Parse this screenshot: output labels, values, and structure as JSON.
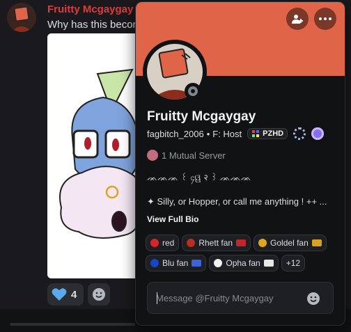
{
  "background_message": {
    "author": "Fruitty Mcgaygay",
    "text": "Why has this becor",
    "reaction": {
      "emoji": "blue-heart",
      "count": "4"
    }
  },
  "profile": {
    "display_name": "Fruitty Mcgaygay",
    "username": "fagbitch_2006",
    "separator": "•",
    "pronoun_tag": "F: Host",
    "guild_tag": "PZHD",
    "status": "offline",
    "mutual_servers": "1 Mutual Server",
    "bio_line1": "ᨏᨏᨏ ꒰ ၄ୱ २ ꒱ ᨏᨏᨏ",
    "bio_line2": "✦ Silly, or Hopper, or call me anything ! ++ ...",
    "view_full_bio": "View Full Bio",
    "roles": [
      {
        "name": "red",
        "color": "#d9252a",
        "emoji": ""
      },
      {
        "name": "Rhett fan",
        "color": "#b5301f",
        "emoji": "rhett-emoji"
      },
      {
        "name": "Goldel fan",
        "color": "#e3a51b",
        "emoji": "goldel-emoji"
      },
      {
        "name": "Blu fan",
        "color": "#1747c9",
        "emoji": "blu-emoji"
      },
      {
        "name": "Opha fan",
        "color": "#f2f2f2",
        "emoji": "opha-emoji"
      }
    ],
    "more_roles": "+12",
    "message_placeholder": "Message @Fruitty Mcgaygay"
  },
  "colors": {
    "banner": "#e06448",
    "popout_bg": "#111214",
    "author_red": "#e03b3b"
  }
}
